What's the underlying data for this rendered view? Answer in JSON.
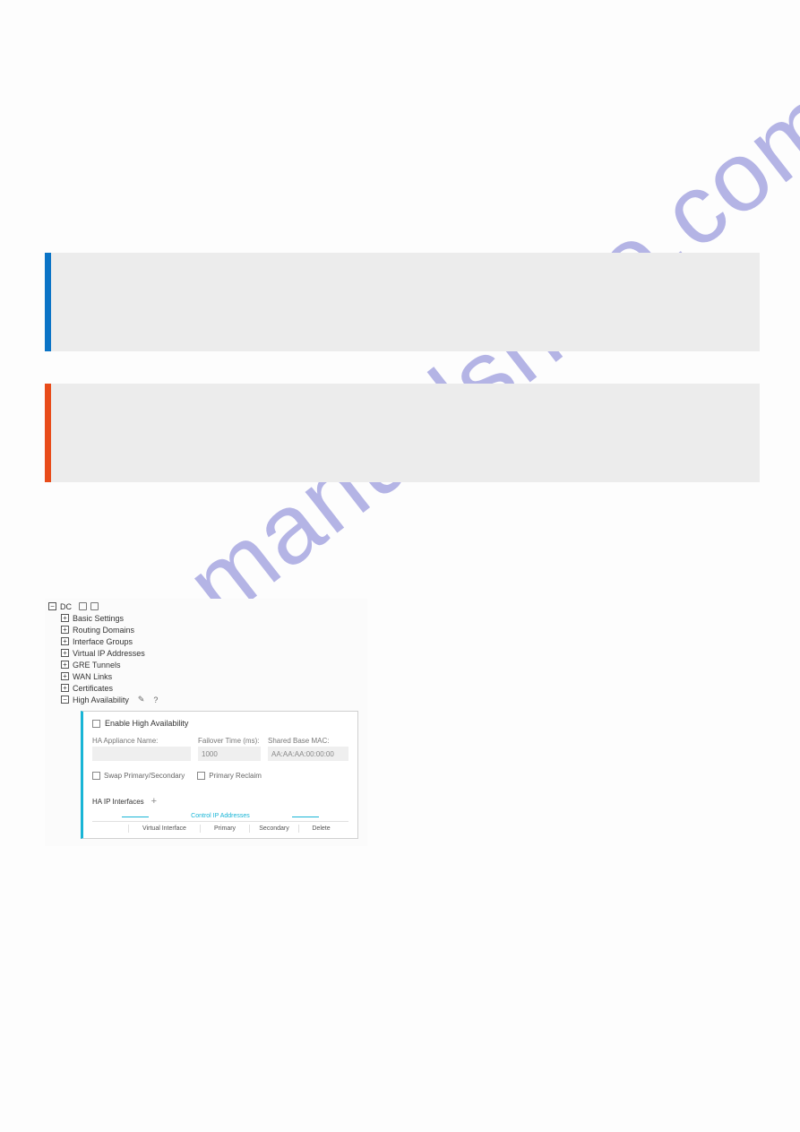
{
  "watermark": "manualshive.com",
  "tree": {
    "root": "DC",
    "root_expanded_glyph": "−",
    "child_collapsed_glyph": "+",
    "child_expanded_glyph": "−",
    "items": [
      {
        "label": "Basic Settings"
      },
      {
        "label": "Routing Domains"
      },
      {
        "label": "Interface Groups"
      },
      {
        "label": "Virtual IP Addresses"
      },
      {
        "label": "GRE Tunnels"
      },
      {
        "label": "WAN Links"
      },
      {
        "label": "Certificates"
      }
    ],
    "ha_label": "High Availability"
  },
  "ha_panel": {
    "enable_label": "Enable High Availability",
    "fields": {
      "appliance_label": "HA Appliance Name:",
      "appliance_value": "",
      "failover_label": "Failover Time (ms):",
      "failover_value": "1000",
      "mac_label": "Shared Base MAC:",
      "mac_value": "AA:AA:AA:00:00:00"
    },
    "swap_label": "Swap Primary/Secondary",
    "reclaim_label": "Primary Reclaim",
    "interfaces_title": "HA IP Interfaces",
    "bracket_title": "Control IP Addresses",
    "table": {
      "cols": {
        "vi": "Virtual Interface",
        "primary": "Primary",
        "secondary": "Secondary",
        "delete": "Delete"
      }
    }
  }
}
